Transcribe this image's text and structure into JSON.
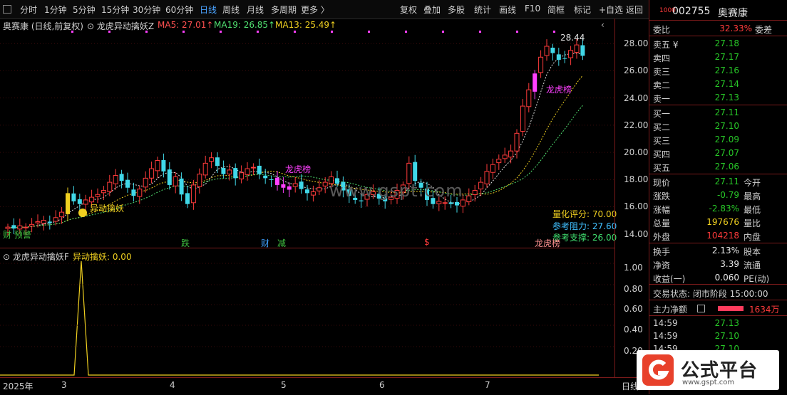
{
  "toolbar": {
    "left": [
      "分时",
      "1分钟",
      "5分钟",
      "15分钟",
      "30分钟",
      "60分钟",
      "日线",
      "周线",
      "月线",
      "多周期",
      "更多 〉"
    ],
    "active": "日线",
    "right": [
      "复权",
      "叠加",
      "多股",
      "统计",
      "画线",
      "F10",
      "简框",
      "标记",
      "+自选",
      "返回"
    ]
  },
  "main": {
    "stock_label": "奥赛康 (日线,前复权)",
    "indicator_name": "龙虎异动擒妖Z",
    "ma": [
      {
        "label": "MA5: 27.01↑",
        "color": "#ff5050"
      },
      {
        "label": "MA19: 26.85↑",
        "color": "#50e070"
      },
      {
        "label": "MA13: 25.49↑",
        "color": "#f0d020"
      }
    ],
    "price_max_label": "28.44",
    "y_ticks": [
      "28.00",
      "26.00",
      "24.00",
      "22.00",
      "20.00",
      "18.00",
      "16.00",
      "14.00"
    ],
    "annotations": {
      "yidong": "异动擒妖",
      "bottom_left": "财 预警",
      "tag_die": "跌",
      "tag_cai": "财",
      "tag_jian": "减",
      "tag_dollar": "$",
      "tag_lhb": "龙虎榜",
      "tag_lhb2": "龙虎榜",
      "tag_lhb3": "龙虎榜"
    },
    "metrics": [
      {
        "label": "量化评分: 70.00",
        "color": "#f0d020"
      },
      {
        "label": "参考阻力: 27.60",
        "color": "#40c0ff"
      },
      {
        "label": "参考支撑: 26.00",
        "color": "#40e070"
      }
    ],
    "watermark": "www.gspt.com"
  },
  "sub": {
    "title": "龙虎异动擒妖F",
    "value": "异动擒妖: 0.00",
    "y_ticks": [
      "1.00",
      "0.80",
      "0.60",
      "0.40",
      "0.20"
    ]
  },
  "dates": [
    "2025年",
    "3",
    "4",
    "5",
    "6",
    "7",
    "日线"
  ],
  "panel": {
    "code": "002755",
    "name": "奥赛康",
    "weibi_label": "委比",
    "weibi_value": "32.33%",
    "weicha_label": "委差",
    "asks": [
      {
        "label": "卖五 ¥",
        "price": "27.18"
      },
      {
        "label": "卖四",
        "price": "27.17"
      },
      {
        "label": "卖三",
        "price": "27.16"
      },
      {
        "label": "卖二",
        "price": "27.14"
      },
      {
        "label": "卖一",
        "price": "27.13"
      }
    ],
    "bids": [
      {
        "label": "买一",
        "price": "27.11"
      },
      {
        "label": "买二",
        "price": "27.10"
      },
      {
        "label": "买三",
        "price": "27.09"
      },
      {
        "label": "买四",
        "price": "27.07"
      },
      {
        "label": "买五",
        "price": "27.06"
      }
    ],
    "stats": [
      {
        "k": "现价",
        "v": "27.11",
        "vc": "green",
        "k2": "今开"
      },
      {
        "k": "涨跌",
        "v": "-0.79",
        "vc": "green",
        "k2": "最高"
      },
      {
        "k": "涨幅",
        "v": "-2.83%",
        "vc": "green",
        "k2": "最低"
      },
      {
        "k": "总量",
        "v": "197676",
        "vc": "yellow",
        "k2": "量比"
      },
      {
        "k": "外盘",
        "v": "104218",
        "vc": "red",
        "k2": "内盘"
      }
    ],
    "stats2": [
      {
        "k": "换手",
        "v": "2.13%",
        "k2": "股本"
      },
      {
        "k": "净资",
        "v": "3.39",
        "k2": "流通"
      },
      {
        "k": "收益(一)",
        "v": "0.060",
        "k2": "PE(动)"
      }
    ],
    "trade_status": "交易状态: 闭市阶段 15:00:00",
    "main_flow_label": "主力净额",
    "main_flow_value": "1634万",
    "ticks": [
      {
        "t": "14:59",
        "p": "27.13"
      },
      {
        "t": "14:59",
        "p": "27.10"
      },
      {
        "t": "14:59",
        "p": "27.10"
      }
    ]
  },
  "brand": {
    "name": "公式平台",
    "url": "www.gspt.com"
  },
  "chart_data": {
    "type": "candlestick",
    "y_axis": {
      "min": 13.2,
      "max": 28.9,
      "ticks": [
        14,
        16,
        18,
        20,
        22,
        24,
        26,
        28
      ]
    },
    "close": [
      14.5,
      14.4,
      14.6,
      14.5,
      14.7,
      14.9,
      15.0,
      14.8,
      15.2,
      15.6,
      17.0,
      16.4,
      16.2,
      16.5,
      16.7,
      16.9,
      17.2,
      17.8,
      18.3,
      17.9,
      17.4,
      16.8,
      17.3,
      18.1,
      18.8,
      19.4,
      18.6,
      17.6,
      18.2,
      16.9,
      16.2,
      17.6,
      18.4,
      19.2,
      19.6,
      19.0,
      18.4,
      18.7,
      18.1,
      18.5,
      18.8,
      18.9,
      18.4,
      18.1,
      18.0,
      17.6,
      17.4,
      17.5,
      17.7,
      17.3,
      17.0,
      17.1,
      17.4,
      17.8,
      18.2,
      17.7,
      17.2,
      16.8,
      16.5,
      16.4,
      16.9,
      17.1,
      16.6,
      16.4,
      16.7,
      17.2,
      17.6,
      19.2,
      17.9,
      17.4,
      16.5,
      16.2,
      16.4,
      16.3,
      16.2,
      16.1,
      16.5,
      16.8,
      17.2,
      17.8,
      18.6,
      19.1,
      19.5,
      19.8,
      20.1,
      21.4,
      23.4,
      24.6,
      25.8,
      27.0,
      27.8,
      27.3,
      26.8,
      26.9,
      27.5,
      27.9,
      27.1
    ]
  }
}
